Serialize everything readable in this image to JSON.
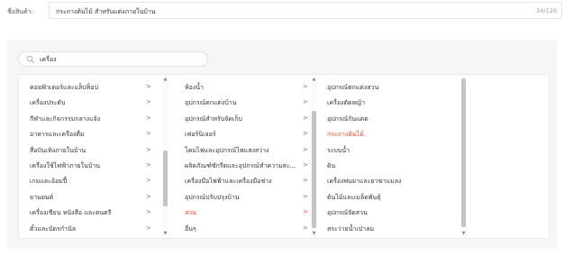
{
  "product": {
    "label": "ชื่อสินค้า:",
    "value": "กระถางต้นไม้ สำหรับแต่งภายในบ้าน",
    "char_count": "34/120"
  },
  "search": {
    "value": "เครื่อง",
    "icon": "search-icon"
  },
  "categories": {
    "col1": [
      {
        "label": "คอมพิวเตอร์และแล็ปท็อป",
        "active": false
      },
      {
        "label": "เครื่องประดับ",
        "active": false
      },
      {
        "label": "กีฬาและกิจกรรมกลางแจ้ง",
        "active": false
      },
      {
        "label": "อาหารและเครื่องดื่ม",
        "active": false
      },
      {
        "label": "สื่อบันเทิงภายในบ้าน",
        "active": false
      },
      {
        "label": "เครื่องใช้ไฟฟ้าภายในบ้าน",
        "active": false
      },
      {
        "label": "เกมและอ้อมปี้",
        "active": false
      },
      {
        "label": "ยานยนต์",
        "active": false
      },
      {
        "label": "เครื่องเขียน หนังสือ และดนตรี",
        "active": false
      },
      {
        "label": "ตั๋วและบัตรกำนัล",
        "active": false
      }
    ],
    "col2": [
      {
        "label": "ห้องน้ำ",
        "active": false
      },
      {
        "label": "อุปกรณ์ตกแต่งบ้าน",
        "active": false
      },
      {
        "label": "อุปกรณ์สำหรับจัดเก็บ",
        "active": false
      },
      {
        "label": "เฟอร์นิเจอร์",
        "active": false
      },
      {
        "label": "โคมไฟและอุปกรณ์ไฟแสงสว่าง",
        "active": false
      },
      {
        "label": "ผลิตภัณฑ์ซักรีดและอุปกรณ์ทำความสะ...",
        "active": false
      },
      {
        "label": "เครื่องมือไฟฟ้าและเครื่องมือช่าง",
        "active": false
      },
      {
        "label": "อุปกรณ์ปรับปรุงบ้าน",
        "active": false
      },
      {
        "label": "สวน",
        "active": true
      },
      {
        "label": "อื่นๆ",
        "active": false
      }
    ],
    "col3": [
      {
        "label": "อุปกรณ์ตกแต่งสวน",
        "active": false
      },
      {
        "label": "เครื่องตัดหญ้า",
        "active": false
      },
      {
        "label": "อุปกรณ์กันแดด",
        "active": false
      },
      {
        "label": "กระถางต้นไม้",
        "active": true
      },
      {
        "label": "ระบบน้ำ",
        "active": false
      },
      {
        "label": "ดิน",
        "active": false
      },
      {
        "label": "เครื่องพ่นยาและยาฆ่าแมลง",
        "active": false
      },
      {
        "label": "ต้นไม้และเมล็ดพันธุ์",
        "active": false
      },
      {
        "label": "อุปกรณ์จัดสวน",
        "active": false
      },
      {
        "label": "สระว่ายน้ำเป่าลม",
        "active": false
      }
    ],
    "chevron": ">",
    "accent_color": "#ee4d2d"
  }
}
